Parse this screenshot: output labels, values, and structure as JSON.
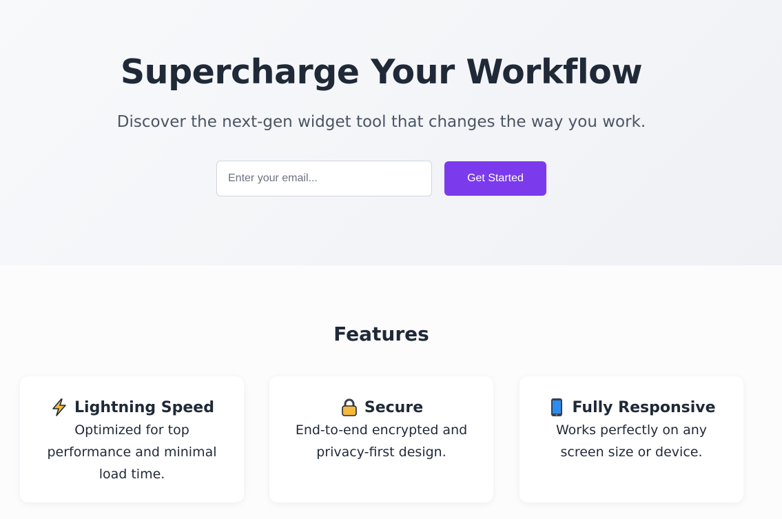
{
  "hero": {
    "title": "Supercharge Your Workflow",
    "subtitle": "Discover the next-gen widget tool that changes the way you work.",
    "email_placeholder": "Enter your email...",
    "cta_label": "Get Started"
  },
  "features": {
    "title": "Features",
    "items": [
      {
        "icon": "lightning-icon",
        "title": "Lightning Speed",
        "description": "Optimized for top performance and minimal load time."
      },
      {
        "icon": "lock-icon",
        "title": "Secure",
        "description": "End-to-end encrypted and privacy-first design."
      },
      {
        "icon": "phone-icon",
        "title": "Fully Responsive",
        "description": "Works perfectly on any screen size or device."
      }
    ]
  },
  "colors": {
    "accent": "#7c3aed",
    "heading": "#1f2937",
    "subtitle": "#4b5563"
  }
}
